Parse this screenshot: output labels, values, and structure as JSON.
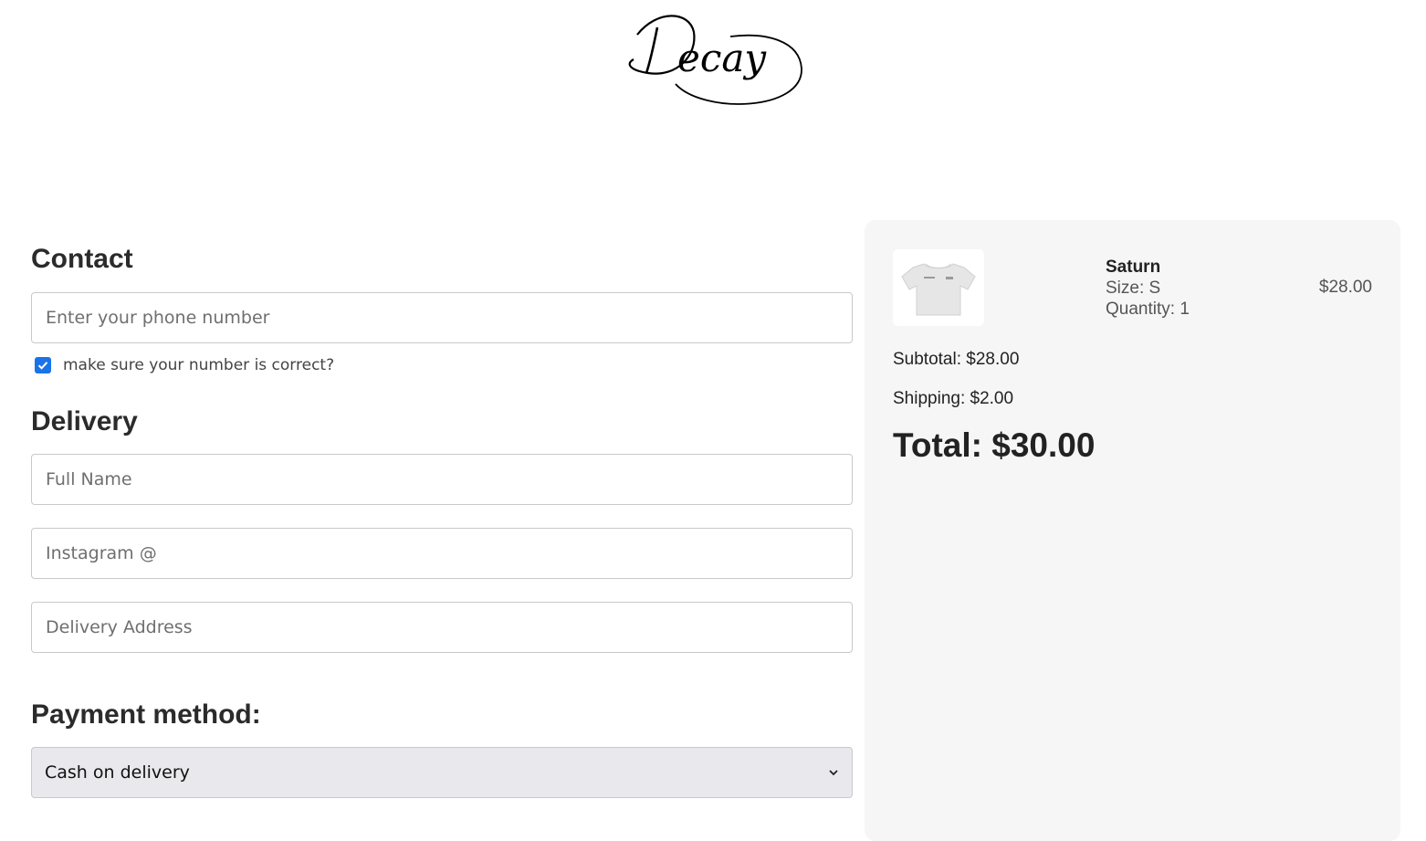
{
  "brand": {
    "logo_text": "Decay"
  },
  "contact": {
    "title": "Contact",
    "phone_placeholder": "Enter your phone number",
    "confirm_label": "make sure your number is correct?",
    "confirm_checked": true
  },
  "delivery": {
    "title": "Delivery",
    "name_placeholder": "Full Name",
    "instagram_placeholder": "Instagram @",
    "address_placeholder": "Delivery Address"
  },
  "payment": {
    "title": "Payment method:",
    "selected": "Cash on delivery"
  },
  "summary": {
    "item": {
      "name": "Saturn",
      "size": "Size: S",
      "quantity": "Quantity: 1",
      "price": "$28.00",
      "image_icon": "tshirt-icon"
    },
    "subtotal": "Subtotal: $28.00",
    "shipping": "Shipping: $2.00",
    "total": "Total: $30.00"
  },
  "colors": {
    "checkbox": "#1a73e8",
    "summary_bg": "#f6f6f6",
    "select_bg": "#e9e9ed"
  }
}
